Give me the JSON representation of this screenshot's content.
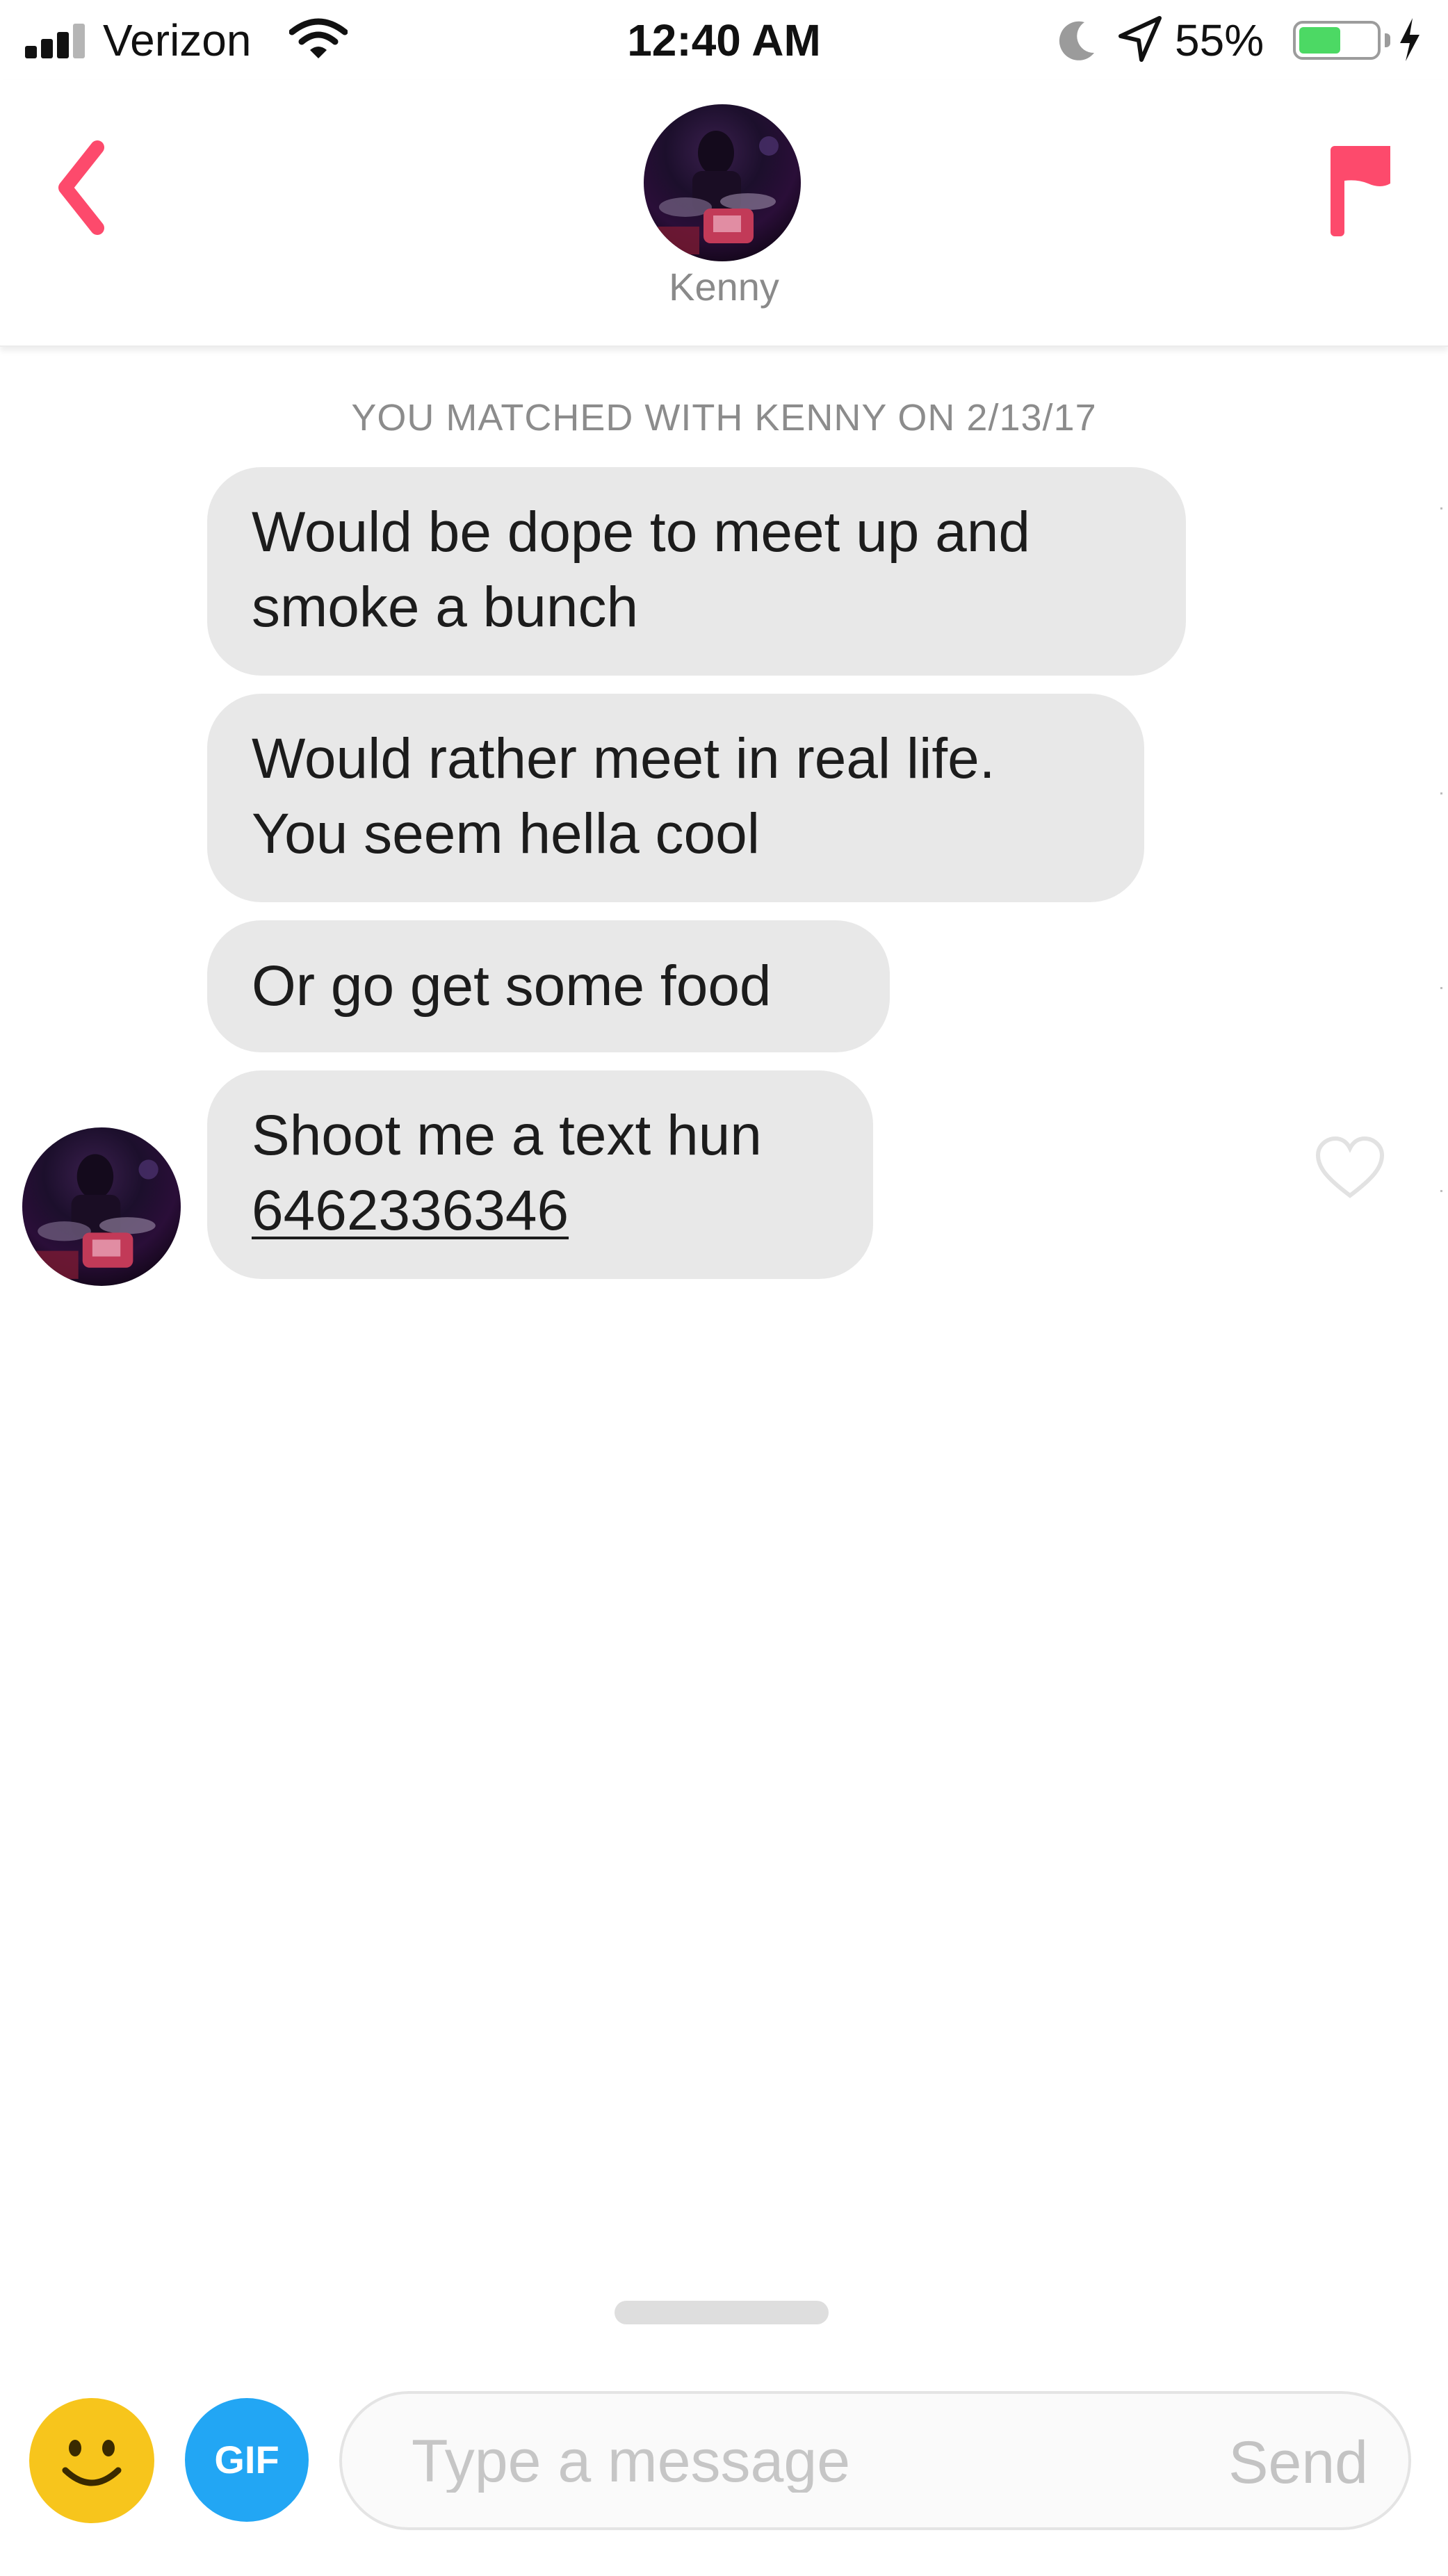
{
  "status_bar": {
    "carrier": "Verizon",
    "time": "12:40 AM",
    "battery_percent_label": "55%",
    "battery_level": 0.55,
    "icons": [
      "signal-icon",
      "wifi-icon",
      "moon-icon",
      "location-icon",
      "battery-icon",
      "charging-icon"
    ]
  },
  "header": {
    "contact_name": "Kenny",
    "back_icon": "chevron-left-icon",
    "flag_icon": "flag-icon"
  },
  "conversation": {
    "match_notice": "YOU MATCHED WITH KENNY ON 2/13/17",
    "messages": [
      {
        "lines": [
          "Would be dope to meet up and",
          "smoke a bunch"
        ]
      },
      {
        "lines": [
          "Would rather meet in real life.",
          "You seem hella cool"
        ]
      },
      {
        "lines": [
          "Or go get some food"
        ]
      },
      {
        "lines": [
          "Shoot me a text hun",
          "6462336346"
        ]
      }
    ]
  },
  "composer": {
    "gif_label": "GIF",
    "placeholder": "Type a message",
    "send_label": "Send"
  },
  "colors": {
    "accent": "#fd4a6c",
    "bubble": "#e8e8e8",
    "gif_blue": "#22a6f4",
    "emoji_yellow": "#f7c51c",
    "battery_green": "#4cd964"
  }
}
